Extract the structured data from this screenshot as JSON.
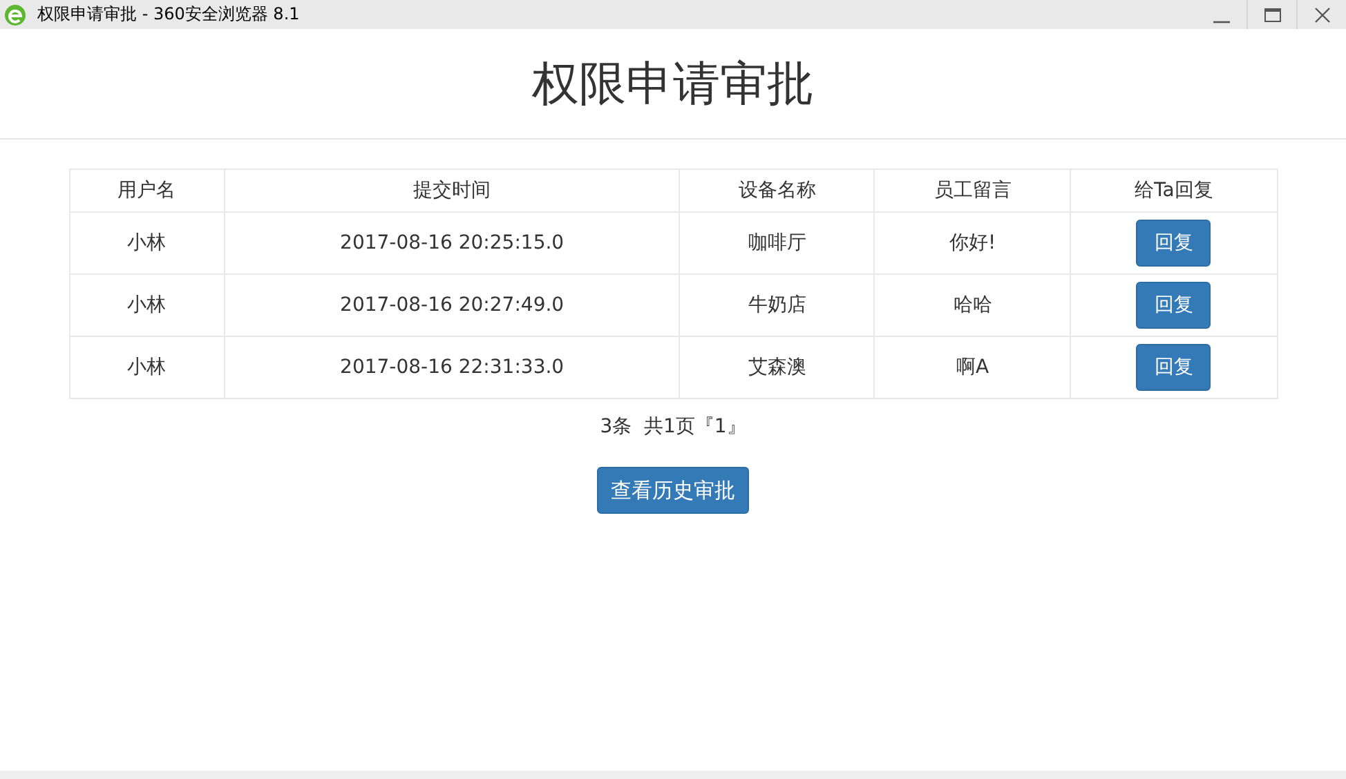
{
  "window": {
    "title": "权限申请审批 - 360安全浏览器 8.1"
  },
  "heading": "权限申请审批",
  "table": {
    "columns": [
      "用户名",
      "提交时间",
      "设备名称",
      "员工留言",
      "给Ta回复"
    ],
    "rows": [
      {
        "user": "小林",
        "time": "2017-08-16 20:25:15.0",
        "device": "咖啡厅",
        "message": "你好!",
        "reply": "回复"
      },
      {
        "user": "小林",
        "time": "2017-08-16 20:27:49.0",
        "device": "牛奶店",
        "message": "哈哈",
        "reply": "回复"
      },
      {
        "user": "小林",
        "time": "2017-08-16 22:31:33.0",
        "device": "艾森澳",
        "message": "啊A",
        "reply": "回复"
      }
    ]
  },
  "pagination": "3条  共1页『1』",
  "history_button": "查看历史审批"
}
